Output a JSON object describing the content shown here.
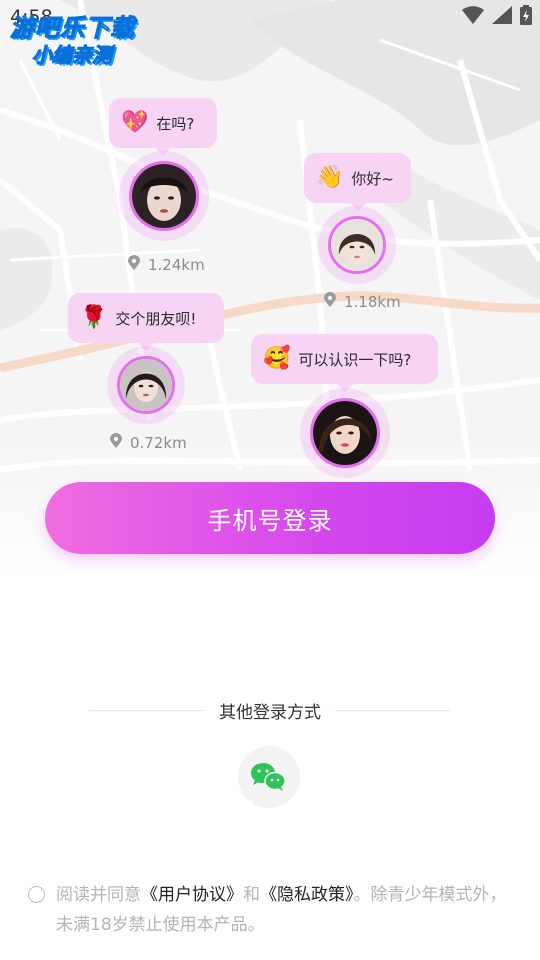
{
  "status_bar": {
    "time": "4:58",
    "wifi_icon": "wifi-icon",
    "signal_icon": "signal-icon",
    "battery_icon": "battery-charging-icon"
  },
  "watermark": {
    "line1": "游吧乐下载",
    "line2": "小编亲测"
  },
  "nearby_users": [
    {
      "message": "在吗?",
      "emoji": "💖",
      "distance": "1.24km"
    },
    {
      "message": "你好~",
      "emoji": "👋",
      "distance": "1.18km"
    },
    {
      "message": "交个朋友呗!",
      "emoji": "🌹",
      "distance": "0.72km"
    },
    {
      "message": "可以认识一下吗?",
      "emoji": "🥰",
      "distance": ""
    }
  ],
  "login": {
    "phone_button_label": "手机号登录"
  },
  "other_login": {
    "label": "其他登录方式",
    "wechat_icon": "wechat-icon"
  },
  "agreement": {
    "prefix": "阅读并同意",
    "user_agreement": "《用户协议》",
    "and": "和",
    "privacy_policy": "《隐私政策》",
    "suffix": "。除青少年模式外，未满18岁禁止使用本产品。"
  },
  "colors": {
    "accent_start": "#f06de0",
    "accent_end": "#c53cf0",
    "bubble_bg": "#f7d3f4"
  }
}
